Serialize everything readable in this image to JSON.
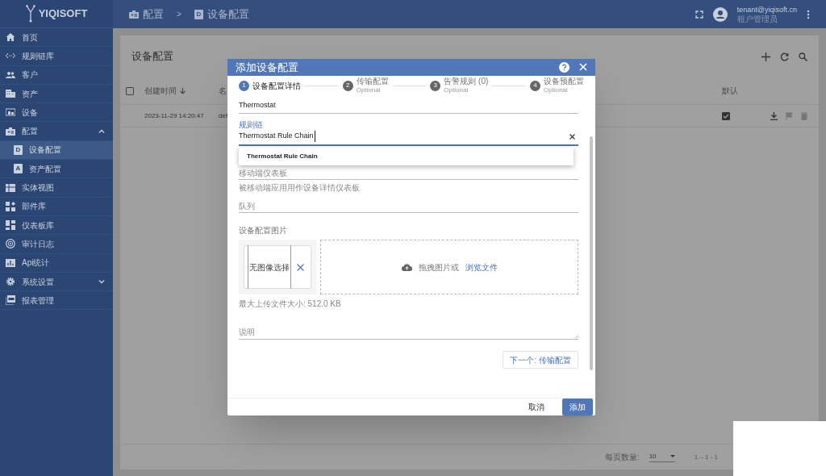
{
  "brand": {
    "name": "YIQISOFT"
  },
  "breadcrumb": [
    {
      "label": "配置"
    },
    {
      "label": "设备配置",
      "badge": "D"
    }
  ],
  "breadcrumb_separator": ">",
  "user": {
    "email": "tenant@yiqisoft.cn",
    "role": "租户管理员"
  },
  "sidebar": {
    "items": [
      {
        "label": "首页",
        "selected": false
      },
      {
        "label": "规则链库",
        "selected": false
      },
      {
        "label": "客户",
        "selected": false
      },
      {
        "label": "资产",
        "selected": false
      },
      {
        "label": "设备",
        "selected": false
      },
      {
        "label": "配置",
        "selected": false,
        "expanded": true,
        "children": [
          {
            "label": "设备配置",
            "letter": "D",
            "selected": true
          },
          {
            "label": "资产配置",
            "letter": "A",
            "selected": false
          }
        ]
      },
      {
        "label": "实体视图",
        "selected": false
      },
      {
        "label": "部件库",
        "selected": false
      },
      {
        "label": "仪表板库",
        "selected": false
      },
      {
        "label": "审计日志",
        "selected": false
      },
      {
        "label": "Api统计",
        "selected": false
      },
      {
        "label": "系统设置",
        "selected": false,
        "expanded": false
      },
      {
        "label": "报表管理",
        "selected": false
      }
    ]
  },
  "card": {
    "title": "设备配置",
    "select_all_checked": false,
    "columns": [
      "创建时间",
      "名",
      "默认"
    ],
    "rows": [
      {
        "created": "2023-11-29 14:20:47",
        "name": "def",
        "default": true
      }
    ],
    "paginator": {
      "label": "每页数量:",
      "page_size": "10",
      "range": "1 – 1 - 1"
    }
  },
  "dialog": {
    "title": "添加设备配置",
    "steps": [
      {
        "number": "1",
        "label": "设备配置详情",
        "selected": true
      },
      {
        "number": "2",
        "label": "传输配置",
        "sublabel": "Optional",
        "selected": false
      },
      {
        "number": "3",
        "label": "告警规则 (0)",
        "sublabel": "Optional",
        "selected": false
      },
      {
        "number": "4",
        "label": "设备预配置",
        "sublabel": "Optional",
        "selected": false
      }
    ],
    "name_value": "Thermostat",
    "rule_chain": {
      "label": "规则链",
      "value": "Thermostat Rule Chain",
      "options": [
        "Thermostat Rule Chain"
      ]
    },
    "mobile_dashboard": {
      "placeholder": "移动端仪表板",
      "hint": "被移动端应用用作设备详情仪表板"
    },
    "queue": {
      "placeholder": "队列"
    },
    "image": {
      "label": "设备配置图片",
      "empty": "无图像选择",
      "drop_text": "拖拽图片或",
      "browse": "浏览文件",
      "max_size": "最大上传文件大小: 512.0 KB"
    },
    "description": {
      "placeholder": "说明"
    },
    "next_button": "下一个: 传输配置",
    "cancel": "取消",
    "add": "添加"
  }
}
